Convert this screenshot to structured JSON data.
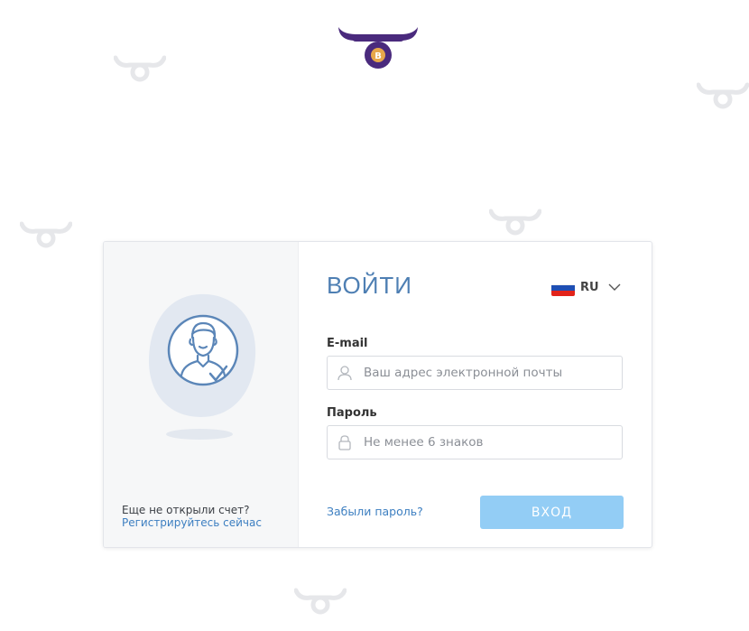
{
  "brand": {
    "logo_icon": "bull-horns-bitcoin-icon",
    "coin_symbol": "B",
    "primary_color": "#4a2a7d",
    "coin_color": "#e7a74a"
  },
  "login": {
    "title": "ВОЙТИ",
    "language": {
      "code": "RU",
      "flag_icon": "russia-flag-icon"
    },
    "email": {
      "label": "E-mail",
      "placeholder": "Ваш адрес электронной почты",
      "value": ""
    },
    "password": {
      "label": "Пароль",
      "placeholder": "Не менее 6 знаков",
      "value": ""
    },
    "forgot_label": "Забыли пароль?",
    "submit_label": "ВХОД",
    "submit_color": "#93cdf5"
  },
  "signup": {
    "prompt": "Еще не открыли счет?",
    "link": "Регистрируйтесь сейчас"
  },
  "colors": {
    "accent": "#3d7fc1",
    "title": "#4e7fb3",
    "bg_logo": "#e6e7ea"
  }
}
